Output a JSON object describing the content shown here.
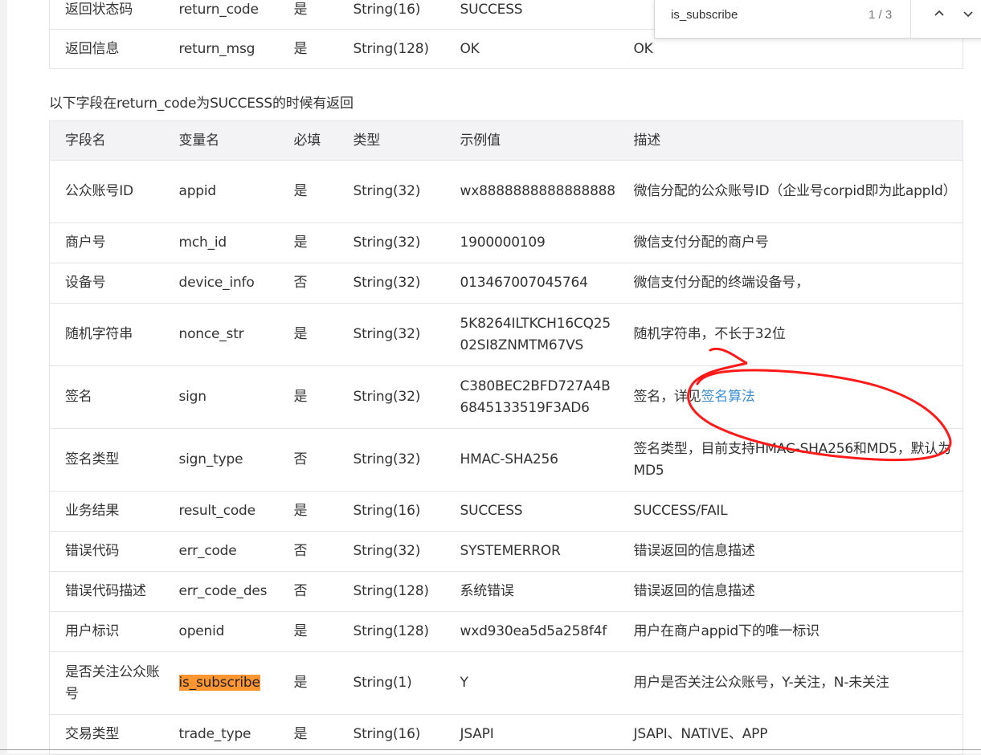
{
  "find_bar": {
    "query": "is_subscribe",
    "count": "1 / 3"
  },
  "top_rows": [
    [
      "返回状态码",
      "return_code",
      "是",
      "String(16)",
      "SUCCESS",
      ""
    ],
    [
      "返回信息",
      "return_msg",
      "是",
      "String(128)",
      "OK",
      "OK"
    ]
  ],
  "note": "以下字段在return_code为SUCCESS的时候有返回",
  "headers": [
    "字段名",
    "变量名",
    "必填",
    "类型",
    "示例值",
    "描述"
  ],
  "rows": [
    [
      "公众账号ID",
      "appid",
      "是",
      "String(32)",
      "wx8888888888888888",
      "微信分配的公众账号ID（企业号corpid即为此appId）"
    ],
    [
      "商户号",
      "mch_id",
      "是",
      "String(32)",
      "1900000109",
      "微信支付分配的商户号"
    ],
    [
      "设备号",
      "device_info",
      "否",
      "String(32)",
      "013467007045764",
      "微信支付分配的终端设备号，"
    ],
    [
      "随机字符串",
      "nonce_str",
      "是",
      "String(32)",
      "5K8264ILTKCH16CQ2502SI8ZNMTM67VS",
      "随机字符串，不长于32位"
    ],
    [
      "签名",
      "sign",
      "是",
      "String(32)",
      "C380BEC2BFD727A4B6845133519F3AD6",
      "签名，详见"
    ],
    [
      "签名类型",
      "sign_type",
      "否",
      "String(32)",
      "HMAC-SHA256",
      "签名类型，目前支持HMAC-SHA256和MD5，默认为MD5"
    ],
    [
      "业务结果",
      "result_code",
      "是",
      "String(16)",
      "SUCCESS",
      "SUCCESS/FAIL"
    ],
    [
      "错误代码",
      "err_code",
      "否",
      "String(32)",
      "SYSTEMERROR",
      "错误返回的信息描述"
    ],
    [
      "错误代码描述",
      "err_code_des",
      "否",
      "String(128)",
      "系统错误",
      "错误返回的信息描述"
    ],
    [
      "用户标识",
      "openid",
      "是",
      "String(128)",
      "wxd930ea5d5a258f4f",
      "用户在商户appid下的唯一标识"
    ],
    [
      "是否关注公众账号",
      "is_subscribe",
      "是",
      "String(1)",
      "Y",
      "用户是否关注公众账号，Y-关注，N-未关注"
    ],
    [
      "交易类型",
      "trade_type",
      "是",
      "String(16)",
      "JSAPI",
      "JSAPI、NATIVE、APP"
    ]
  ],
  "sign_link": "签名算法",
  "colors": {
    "link": "#3b8fd6",
    "highlight": "#ff9632",
    "annotation": "#ff1a1a",
    "header_bg": "#f3f3f5"
  },
  "icons": [
    "chevron-up-icon",
    "chevron-down-icon"
  ]
}
